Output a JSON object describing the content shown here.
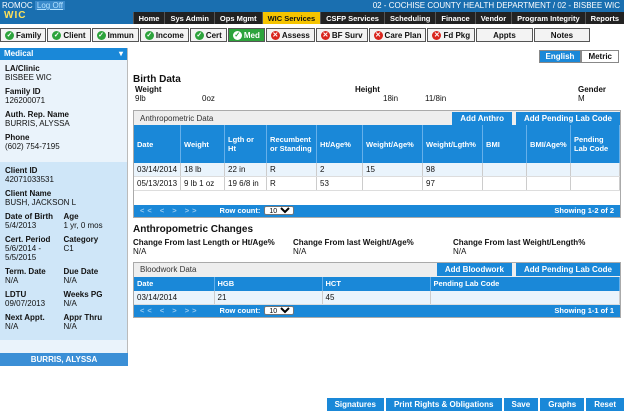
{
  "header": {
    "org": "ROMOC",
    "logout": "Log Off",
    "logo": "WIC",
    "department": "02 - COCHISE COUNTY HEALTH DEPARTMENT / 02 - BISBEE WIC",
    "menu": [
      "Home",
      "Sys Admin",
      "Ops Mgmt",
      "WIC Services",
      "CSFP Services",
      "Scheduling",
      "Finance",
      "Vendor",
      "Program Integrity",
      "Reports"
    ],
    "active_menu": "WIC Services"
  },
  "tabs": [
    {
      "label": "Family",
      "status": "check"
    },
    {
      "label": "Client",
      "status": "check"
    },
    {
      "label": "Immun",
      "status": "check"
    },
    {
      "label": "Income",
      "status": "check"
    },
    {
      "label": "Cert",
      "status": "check"
    },
    {
      "label": "Med",
      "status": "check",
      "active": true
    },
    {
      "label": "Assess",
      "status": "x"
    },
    {
      "label": "BF Surv",
      "status": "x"
    },
    {
      "label": "Care Plan",
      "status": "x"
    },
    {
      "label": "Fd Pkg",
      "status": "x"
    },
    {
      "label": "Appts",
      "status": "none"
    },
    {
      "label": "Notes",
      "status": "none"
    }
  ],
  "sidebar": {
    "header": "Medical",
    "clinic_label": "LA/Clinic",
    "clinic": "BISBEE WIC",
    "family_id_label": "Family ID",
    "family_id": "126200071",
    "rep_label": "Auth. Rep. Name",
    "rep": "BURRIS, ALYSSA",
    "phone_label": "Phone",
    "phone": "(602) 754-7195",
    "client_id_label": "Client ID",
    "client_id": "42071033531",
    "client_name_label": "Client Name",
    "client_name": "BUSH, JACKSON L",
    "dob_label": "Date of Birth",
    "dob": "5/4/2013",
    "age_label": "Age",
    "age": "1 yr, 0 mos",
    "cert_label": "Cert. Period",
    "cert": "5/6/2014 - 5/5/2015",
    "category_label": "Category",
    "category": "C1",
    "term_label": "Term. Date",
    "term": "N/A",
    "due_label": "Due Date",
    "due": "N/A",
    "ldtu_label": "LDTU",
    "ldtu": "09/07/2013",
    "weeks_label": "Weeks PG",
    "weeks": "N/A",
    "next_label": "Next Appt.",
    "next": "N/A",
    "appr_label": "Appr Thru",
    "appr": "N/A",
    "footer": "BURRIS, ALYSSA"
  },
  "lang": {
    "english": "English",
    "metric": "Metric"
  },
  "birth": {
    "title": "Birth Data",
    "weight_label": "Weight",
    "weight_lb": "9lb",
    "weight_oz": "0oz",
    "height_label": "Height",
    "height_in": "18in",
    "height_frac": "11/8in",
    "gender_label": "Gender",
    "gender": "M"
  },
  "anthro": {
    "title": "Anthropometric Data",
    "add": "Add Anthro",
    "add_pending": "Add Pending Lab Code",
    "columns": [
      "Date",
      "Weight",
      "Lgth or Ht",
      "Recumbent or Standing",
      "Ht/Age%",
      "Weight/Age%",
      "Weight/Lgth%",
      "BMI",
      "BMI/Age%",
      "Pending Lab Code"
    ],
    "rows": [
      [
        "03/14/2014",
        "18 lb",
        "22 in",
        "R",
        "2",
        "15",
        "98",
        "",
        "",
        ""
      ],
      [
        "05/13/2013",
        "9 lb 1 oz",
        "19 6/8 in",
        "R",
        "53",
        "",
        "97",
        "",
        "",
        ""
      ]
    ],
    "pager_nav": "<< < > >>",
    "row_count_label": "Row count:",
    "row_count": "10",
    "showing": "Showing 1-2 of 2"
  },
  "changes": {
    "title": "Anthropometric Changes",
    "c1_label": "Change From last Length or Ht/Age%",
    "c1": "N/A",
    "c2_label": "Change From last Weight/Age%",
    "c2": "N/A",
    "c3_label": "Change From last Weight/Length%",
    "c3": "N/A"
  },
  "blood": {
    "title": "Bloodwork Data",
    "add": "Add Bloodwork",
    "add_pending": "Add Pending Lab Code",
    "columns": [
      "Date",
      "HGB",
      "HCT",
      "Pending Lab Code"
    ],
    "rows": [
      [
        "03/14/2014",
        "21",
        "45",
        ""
      ]
    ],
    "pager_nav": "<< < > >>",
    "row_count_label": "Row count:",
    "row_count": "10",
    "showing": "Showing 1-1 of 1"
  },
  "bottom": [
    "Signatures",
    "Print Rights & Obligations",
    "Save",
    "Graphs",
    "Reset"
  ]
}
